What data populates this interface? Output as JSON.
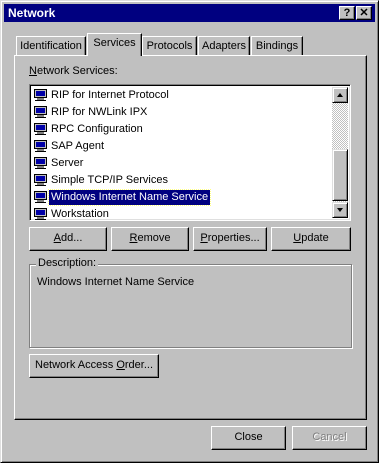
{
  "window": {
    "title": "Network",
    "help_button": "?",
    "close_button": "✕"
  },
  "tabs": [
    {
      "label": "Identification",
      "active": false
    },
    {
      "label": "Services",
      "active": true
    },
    {
      "label": "Protocols",
      "active": false
    },
    {
      "label": "Adapters",
      "active": false
    },
    {
      "label": "Bindings",
      "active": false
    }
  ],
  "services_panel": {
    "list_label_pre": "",
    "list_label_u": "N",
    "list_label_post": "etwork Services:",
    "items": [
      {
        "label": "RIP for Internet Protocol",
        "icon": "network-service-icon"
      },
      {
        "label": "RIP for NWLink IPX",
        "icon": "network-service-icon"
      },
      {
        "label": "RPC Configuration",
        "icon": "network-service-icon"
      },
      {
        "label": "SAP Agent",
        "icon": "network-service-icon"
      },
      {
        "label": "Server",
        "icon": "network-service-icon"
      },
      {
        "label": "Simple TCP/IP Services",
        "icon": "network-service-icon"
      },
      {
        "label": "Windows Internet Name Service",
        "icon": "network-service-icon",
        "selected": true
      },
      {
        "label": "Workstation",
        "icon": "network-service-icon"
      }
    ],
    "buttons": {
      "add": {
        "pre": "",
        "u": "A",
        "post": "dd..."
      },
      "remove": {
        "pre": "",
        "u": "R",
        "post": "emove"
      },
      "properties": {
        "pre": "",
        "u": "P",
        "post": "roperties..."
      },
      "update": {
        "pre": "",
        "u": "U",
        "post": "pdate"
      }
    },
    "description_label": "Description:",
    "description_text": "Windows Internet Name Service",
    "access_order": {
      "pre": "Network Access ",
      "u": "O",
      "post": "rder..."
    }
  },
  "footer": {
    "close_label": "Close",
    "cancel_label": "Cancel"
  },
  "colors": {
    "face": "#c0c0c0",
    "title_bar": "#000080",
    "selection": "#000080"
  }
}
